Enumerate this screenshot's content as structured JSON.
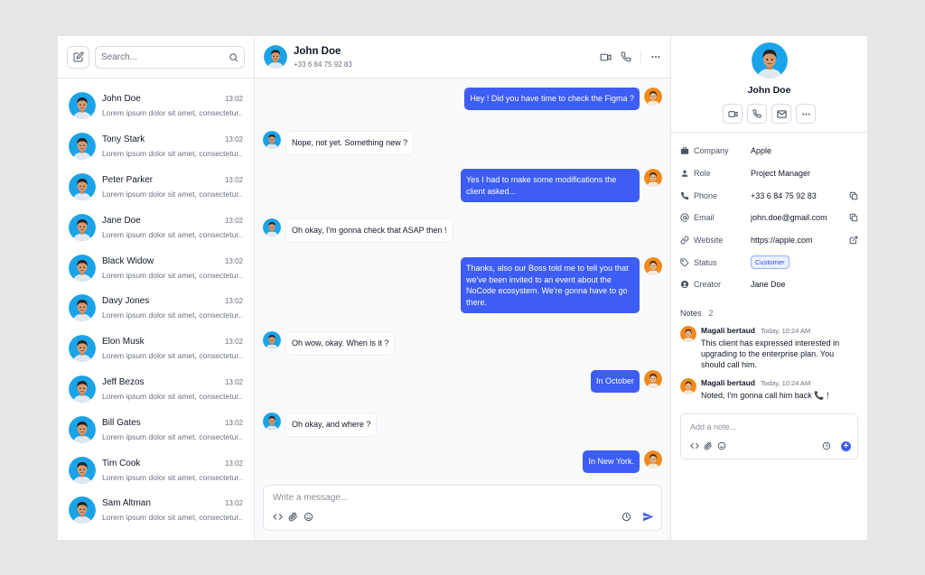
{
  "search": {
    "placeholder": "Search..."
  },
  "contacts": [
    {
      "name": "John Doe",
      "time": "13:02",
      "preview": "Lorem ipsum dolor sit amet, consectetur..."
    },
    {
      "name": "Tony Stark",
      "time": "13:02",
      "preview": "Lorem ipsum dolor sit amet, consectetur..."
    },
    {
      "name": "Peter Parker",
      "time": "13:02",
      "preview": "Lorem ipsum dolor sit amet, consectetur..."
    },
    {
      "name": "Jane Doe",
      "time": "13:02",
      "preview": "Lorem ipsum dolor sit amet, consectetur..."
    },
    {
      "name": "Black Widow",
      "time": "13:02",
      "preview": "Lorem ipsum dolor sit amet, consectetur..."
    },
    {
      "name": "Davy Jones",
      "time": "13:02",
      "preview": "Lorem ipsum dolor sit amet, consectetur..."
    },
    {
      "name": "Elon Musk",
      "time": "13:02",
      "preview": "Lorem ipsum dolor sit amet, consectetur..."
    },
    {
      "name": "Jeff Bezos",
      "time": "13:02",
      "preview": "Lorem ipsum dolor sit amet, consectetur..."
    },
    {
      "name": "Bill Gates",
      "time": "13:02",
      "preview": "Lorem ipsum dolor sit amet, consectetur..."
    },
    {
      "name": "Tim Cook",
      "time": "13:02",
      "preview": "Lorem ipsum dolor sit amet, consectetur..."
    },
    {
      "name": "Sam Altman",
      "time": "13:02",
      "preview": "Lorem ipsum dolor sit amet, consectetur..."
    }
  ],
  "chat": {
    "name": "John Doe",
    "phone": "+33 6 84 75 92 83",
    "messages": [
      {
        "dir": "out",
        "text": "Hey ! Did you have time to check the Figma ?"
      },
      {
        "dir": "in",
        "text": "Nope, not yet. Something new ?"
      },
      {
        "dir": "out",
        "text": "Yes I had to make some modifications the client asked..."
      },
      {
        "dir": "in",
        "text": "Oh okay, I'm gonna check that ASAP then !"
      },
      {
        "dir": "out",
        "text": "Thanks, also our Boss told me to tell you that we've been invited to an event about the NoCode ecosystem. We're gonna have to go there."
      },
      {
        "dir": "in",
        "text": "Oh wow, okay. When is it ?"
      },
      {
        "dir": "out",
        "text": "In October"
      },
      {
        "dir": "in",
        "text": "Oh okay, and where ?"
      },
      {
        "dir": "out",
        "text": "In New York."
      }
    ],
    "composer_placeholder": "Write a message..."
  },
  "profile": {
    "name": "John Doe",
    "details": [
      {
        "label": "Company",
        "value": "Apple",
        "icon": "briefcase-icon"
      },
      {
        "label": "Role",
        "value": "Project Manager",
        "icon": "user-icon"
      },
      {
        "label": "Phone",
        "value": "+33 6 84 75 92 83",
        "icon": "phone-icon",
        "action": "copy-icon"
      },
      {
        "label": "Email",
        "value": "john.doe@gmail.com",
        "icon": "at-icon",
        "action": "copy-icon"
      },
      {
        "label": "Website",
        "value": "https://apple.com",
        "icon": "link-icon",
        "action": "external-link-icon"
      },
      {
        "label": "Status",
        "value": "Customer",
        "icon": "tag-icon"
      },
      {
        "label": "Creator",
        "value": "Jane Doe",
        "icon": "user-circle-icon"
      }
    ],
    "notes_title": "Notes",
    "notes_count": "2",
    "notes": [
      {
        "author": "Magali bertaud",
        "time": "Today, 10:24 AM",
        "text": "This client has expressed interested in upgrading to the enterprise plan. You should call him."
      },
      {
        "author": "Magali bertaud",
        "time": "Today, 10:24 AM",
        "text": "Noted, I'm gonna call him back 📞 !"
      }
    ],
    "note_placeholder": "Add a note..."
  },
  "colors": {
    "accent": "#3d5df5",
    "avatar_blue": "#1aa3e8",
    "avatar_orange": "#f08a1c"
  }
}
